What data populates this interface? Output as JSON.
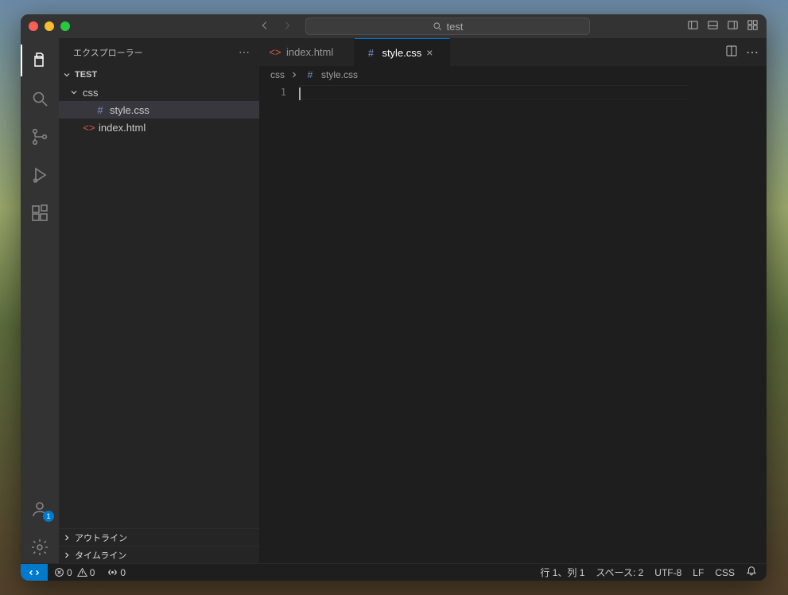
{
  "search": {
    "text": "test"
  },
  "sidebar": {
    "title": "エクスプローラー",
    "workspace": "TEST",
    "folder_css": "css",
    "file_style": "style.css",
    "file_index": "index.html",
    "outline": "アウトライン",
    "timeline": "タイムライン"
  },
  "activity": {
    "account_badge": "1"
  },
  "tabs": [
    {
      "label": "index.html",
      "icon": "html",
      "active": false
    },
    {
      "label": "style.css",
      "icon": "hash",
      "active": true
    }
  ],
  "breadcrumb": {
    "seg1": "css",
    "seg2": "style.css"
  },
  "editor": {
    "line1": "1"
  },
  "status": {
    "errors": "0",
    "warnings": "0",
    "ports": "0",
    "lncol": "行 1、列 1",
    "spaces": "スペース: 2",
    "encoding": "UTF-8",
    "eol": "LF",
    "lang": "CSS"
  }
}
